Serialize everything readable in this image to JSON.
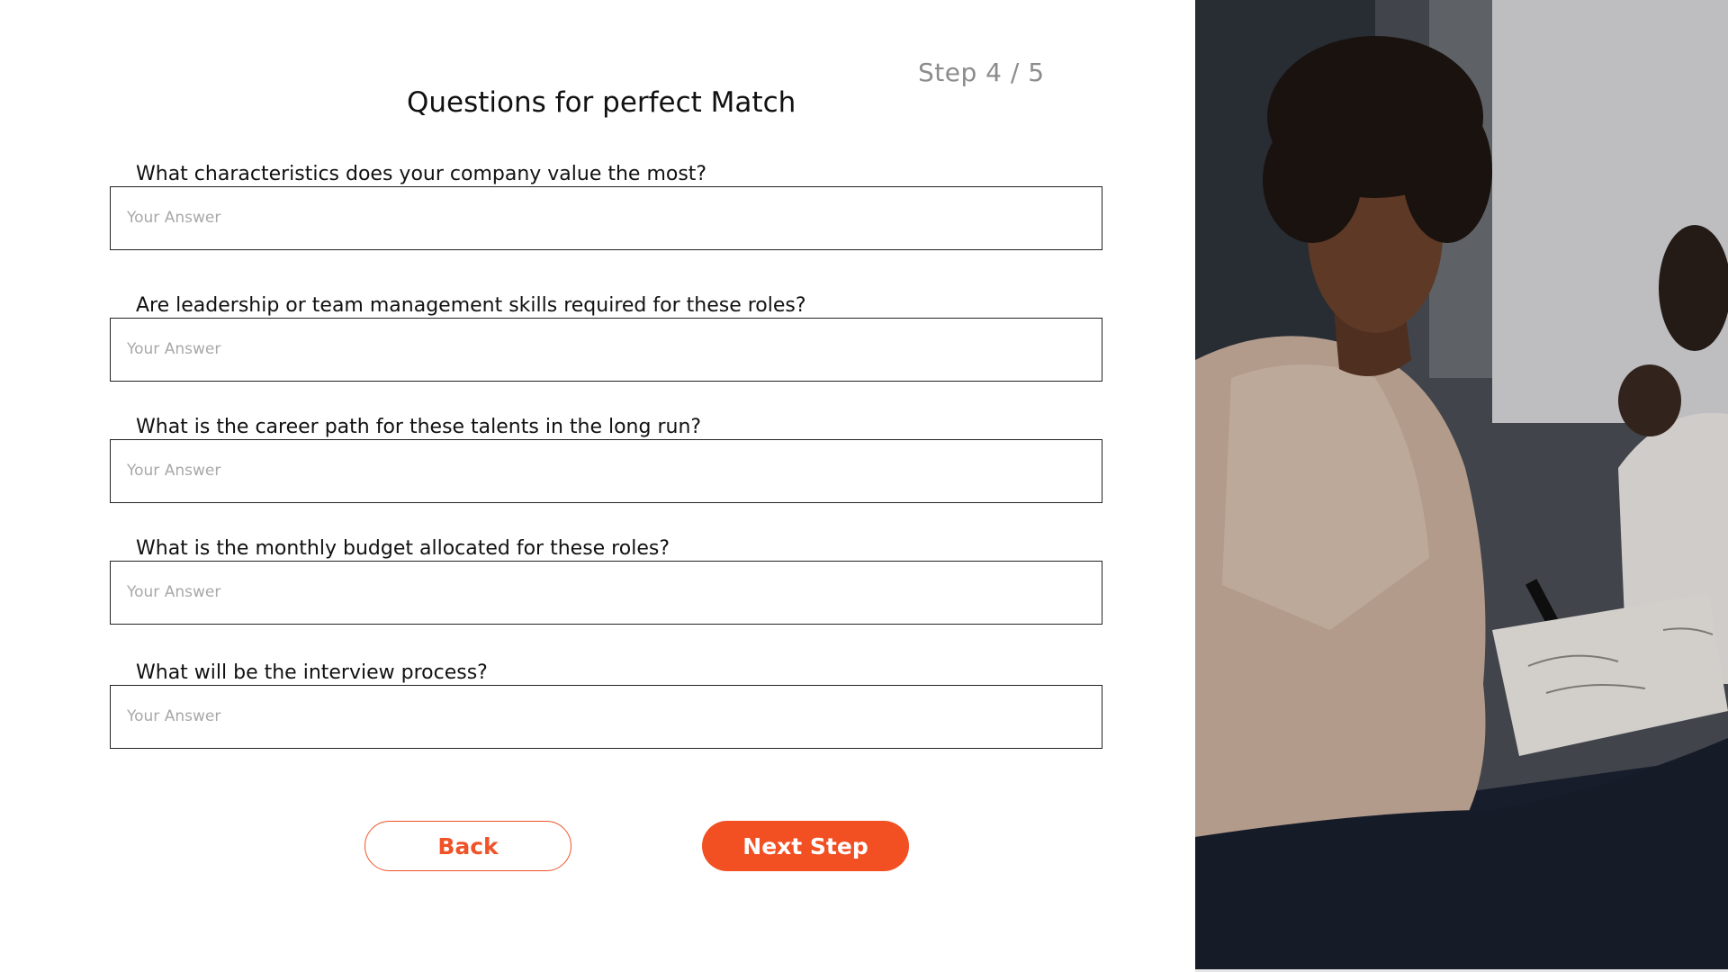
{
  "header": {
    "step": "Step 4 / 5",
    "title": "Questions for perfect Match"
  },
  "questions": [
    {
      "label": "What characteristics does your company value the most?",
      "placeholder": "Your Answer",
      "value": ""
    },
    {
      "label": "Are leadership or team management skills required for these roles?",
      "placeholder": "Your Answer",
      "value": ""
    },
    {
      "label": "What is the career path for these talents in the long run?",
      "placeholder": "Your Answer",
      "value": ""
    },
    {
      "label": "What is the monthly budget allocated for these roles?",
      "placeholder": "Your Answer",
      "value": ""
    },
    {
      "label": "What will be the interview process?",
      "placeholder": "Your Answer",
      "value": ""
    }
  ],
  "buttons": {
    "back": "Back",
    "next": "Next Step"
  },
  "colors": {
    "accent": "#f24f22",
    "text": "#111111",
    "muted": "#8c8c8c",
    "placeholder": "#a8a8a8"
  },
  "photo": {
    "icon": "person-writing-photo"
  }
}
